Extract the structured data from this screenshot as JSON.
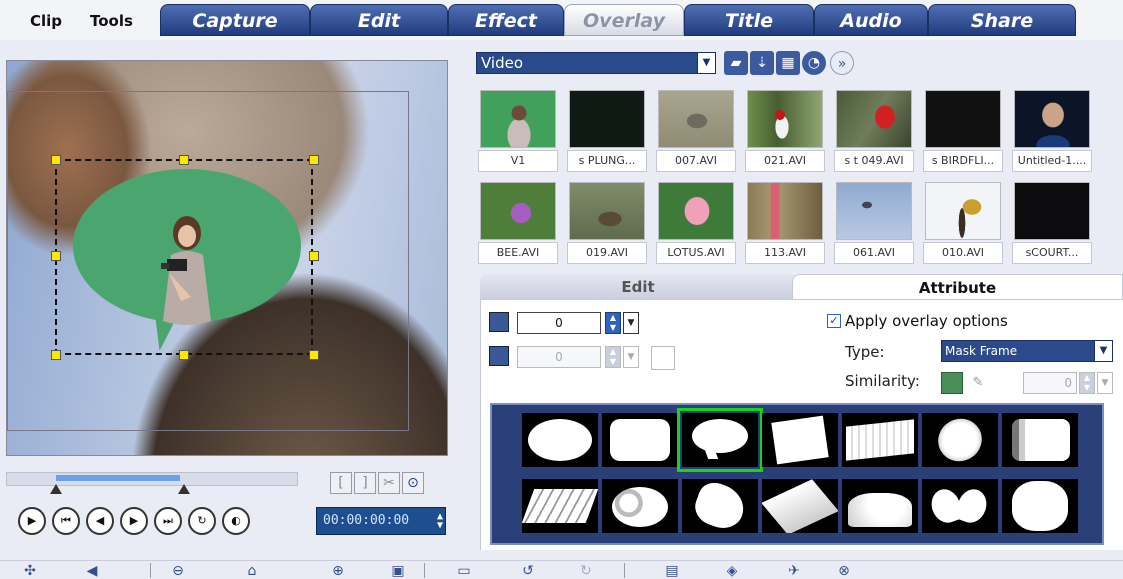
{
  "menu": {
    "clip": "Clip",
    "tools": "Tools"
  },
  "tabs": [
    {
      "label": "Capture",
      "active": false
    },
    {
      "label": "Edit",
      "active": false
    },
    {
      "label": "Effect",
      "active": false
    },
    {
      "label": "Overlay",
      "active": true
    },
    {
      "label": "Title",
      "active": false
    },
    {
      "label": "Audio",
      "active": false
    },
    {
      "label": "Share",
      "active": false
    }
  ],
  "library": {
    "category": "Video",
    "icons": [
      "folder-icon",
      "sort-icon",
      "view-options-icon",
      "capture-icon",
      "expand-icon"
    ],
    "thumbnails": [
      {
        "label": "V1"
      },
      {
        "label": "s PLUNG..."
      },
      {
        "label": "007.AVI"
      },
      {
        "label": "021.AVI"
      },
      {
        "label": "s t  049.AVI"
      },
      {
        "label": "s BIRDFLI..."
      },
      {
        "label": "Untitled-1...."
      },
      {
        "label": "BEE.AVI"
      },
      {
        "label": "019.AVI"
      },
      {
        "label": "LOTUS.AVI"
      },
      {
        "label": "113.AVI"
      },
      {
        "label": "061.AVI"
      },
      {
        "label": "010.AVI"
      },
      {
        "label": "sCOURT..."
      }
    ]
  },
  "options": {
    "tab_edit": "Edit",
    "tab_attribute": "Attribute",
    "transparency_value": "0",
    "border_value": "0",
    "apply_overlay_label": "Apply overlay options",
    "apply_overlay_checked": true,
    "type_label": "Type:",
    "type_value": "Mask Frame",
    "similarity_label": "Similarity:",
    "similarity_value": "0",
    "similarity_color": "#4a8e5a",
    "selected_mask_index": 2
  },
  "transport": {
    "timecode": "00:00:00:00",
    "tool_mark_in": "[",
    "tool_mark_out": "]"
  },
  "colors": {
    "tab_bg": "#213c7d",
    "accent": "#2b4a8c",
    "bubble_green": "#4aa56e",
    "handle_yellow": "#ffe800",
    "mask_selected": "#18d418"
  }
}
